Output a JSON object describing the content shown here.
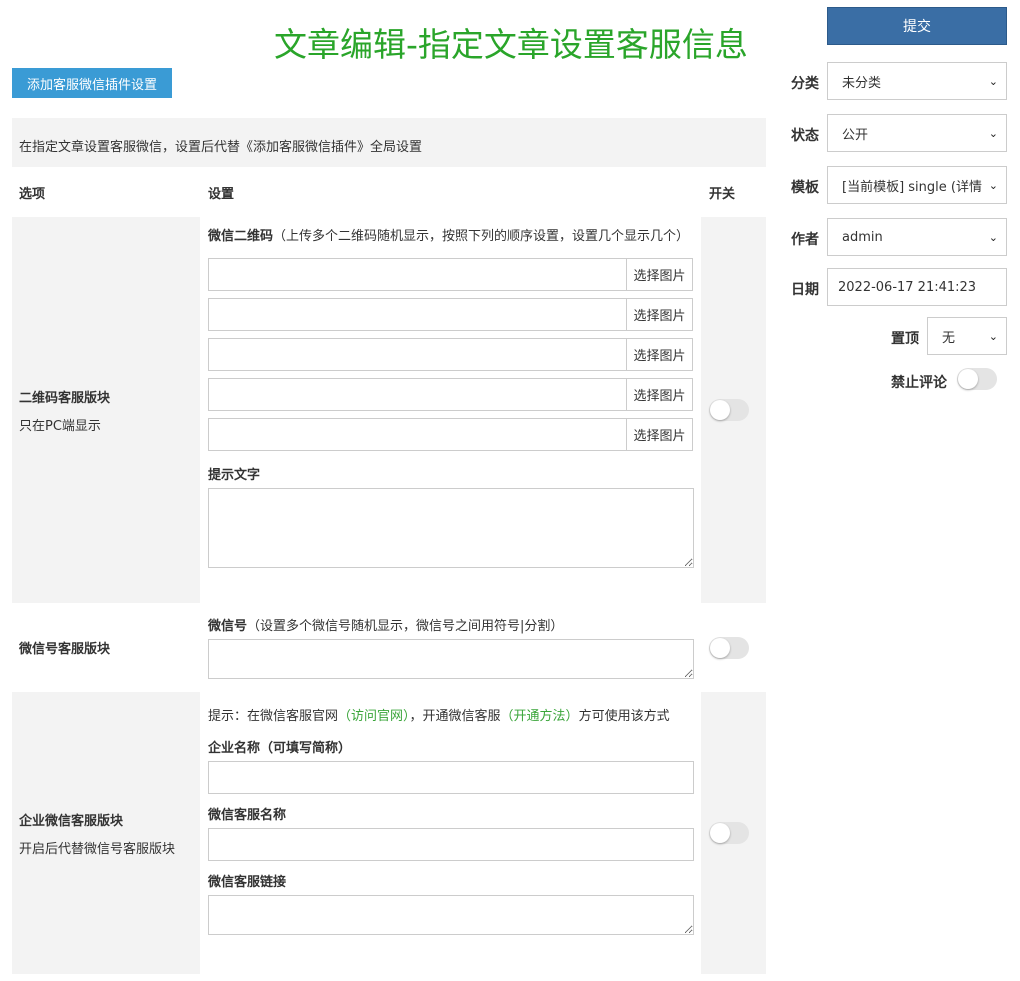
{
  "header": {
    "title": "文章编辑-指定文章设置客服信息",
    "add_button": "添加客服微信插件设置"
  },
  "notice": "在指定文章设置客服微信，设置后代替《添加客服微信插件》全局设置",
  "table_head": {
    "option": "选项",
    "setting": "设置",
    "switch": "开关"
  },
  "qr_block": {
    "title": "二维码客服版块",
    "sub": "只在PC端显示",
    "label_bold": "微信二维码",
    "label_hint": "（上传多个二维码随机显示，按照下列的顺序设置，设置几个显示几个）",
    "choose_image": "选择图片",
    "tip_label": "提示文字",
    "enabled": false
  },
  "wechat_block": {
    "title": "微信号客服版块",
    "label_bold": "微信号",
    "label_hint": "（设置多个微信号随机显示，微信号之间用符号|分割）",
    "enabled": false
  },
  "work_block": {
    "title": "企业微信客服版块",
    "sub": "开启后代替微信号客服版块",
    "tip_prefix": "提示：在微信客服官网",
    "tip_link1": "（访问官网）",
    "tip_mid": "，开通微信客服",
    "tip_link2": "（开通方法）",
    "tip_suffix": "方可使用该方式",
    "company_label": "企业名称（可填写简称）",
    "service_name_label": "微信客服名称",
    "service_link_label": "微信客服链接",
    "enabled": false
  },
  "sidebar": {
    "submit": "提交",
    "category_label": "分类",
    "category_value": "未分类",
    "status_label": "状态",
    "status_value": "公开",
    "template_label": "模板",
    "template_value": "[当前模板] single (详情",
    "author_label": "作者",
    "author_value": "admin",
    "date_label": "日期",
    "date_value": "2022-06-17 21:41:23",
    "sticky_label": "置顶",
    "sticky_value": "无",
    "no_comment_label": "禁止评论",
    "no_comment_enabled": false
  },
  "colors": {
    "title_green": "#2aa52a",
    "add_btn": "#3a9bd5",
    "submit_btn": "#3a6ea5",
    "link_green": "#3aa53a"
  }
}
